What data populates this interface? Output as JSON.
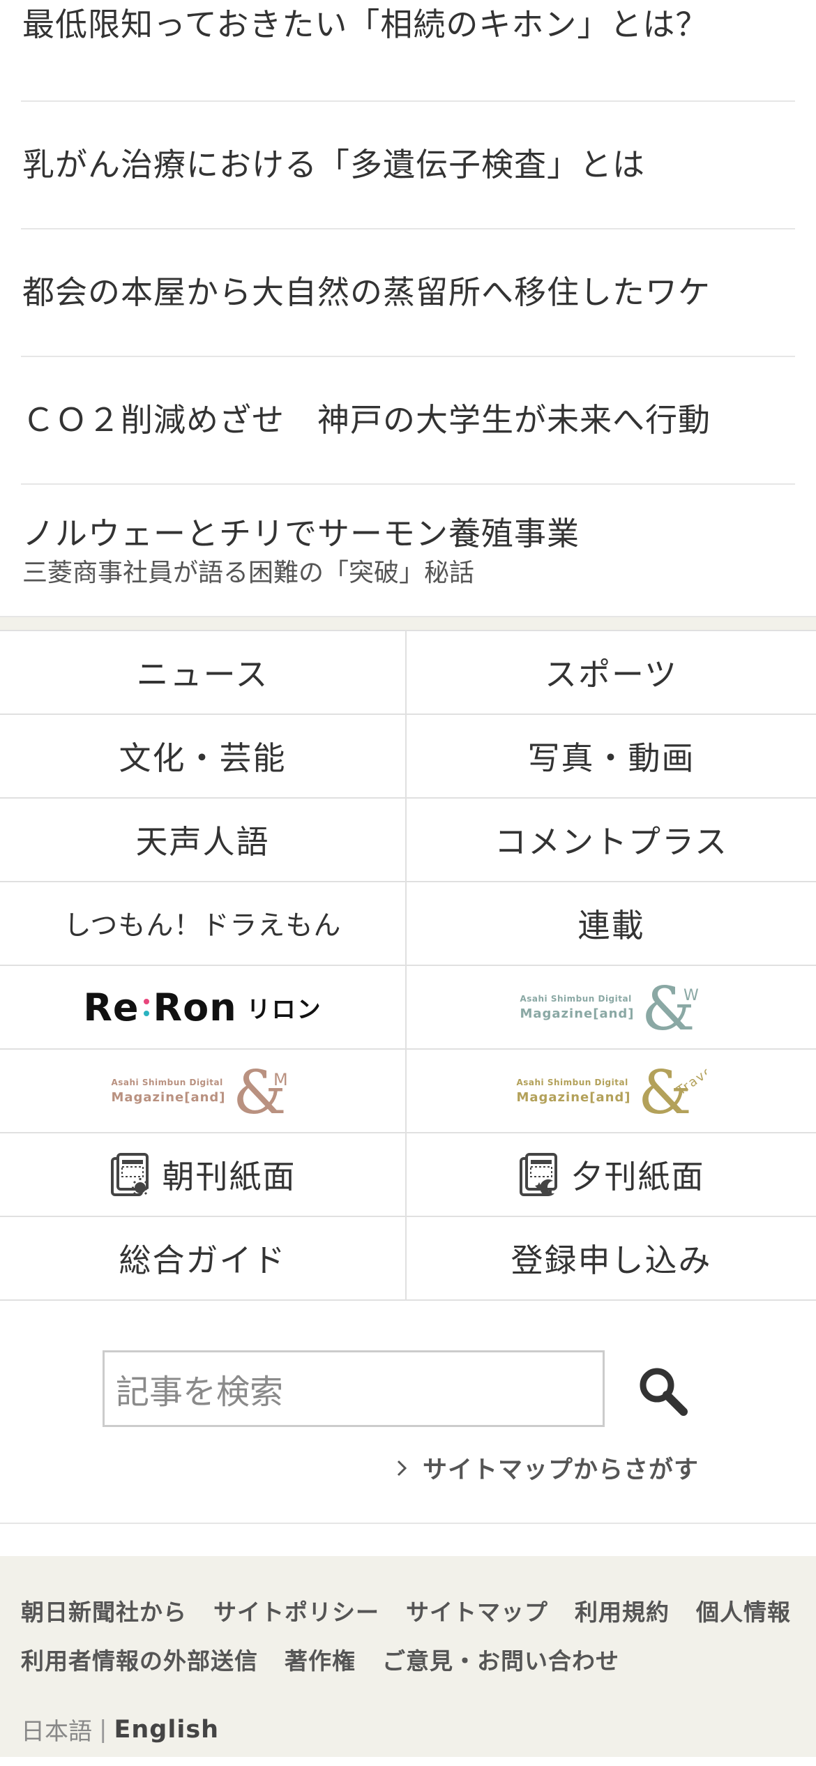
{
  "articles": [
    {
      "headline": "最低限知っておきたい「相続のキホン」とは？"
    },
    {
      "headline": "乳がん治療における「多遺伝子検査」とは"
    },
    {
      "headline": "都会の本屋から大自然の蒸留所へ移住したワケ"
    },
    {
      "headline": "ＣＯ２削減めざせ　神戸の大学生が未来へ行動"
    },
    {
      "headline": "ノルウェーとチリでサーモン養殖事業",
      "subhead": "三菱商事社員が語る困難の「突破」秘話"
    }
  ],
  "grid": {
    "news": "ニュース",
    "sports": "スポーツ",
    "culture": "文化・芸能",
    "photo_video": "写真・動画",
    "tensei_jingo": "天声人語",
    "comment_plus": "コメントプラス",
    "doraemon": "しつもん！ドラえもん",
    "serial": "連載",
    "reron": {
      "main": "Re:Ron",
      "kana": "リロン"
    },
    "magazine_w": {
      "line1": "Asahi Shimbun Digital",
      "line2": "Magazine[and]",
      "mark": "&",
      "suffix": "W",
      "color": "#8aa8a4"
    },
    "magazine_m": {
      "line1": "Asahi Shimbun Digital",
      "line2": "Magazine[and]",
      "mark": "&",
      "suffix": "M",
      "color": "#b99180"
    },
    "magazine_travel": {
      "line1": "Asahi Shimbun Digital",
      "line2": "Magazine[and]",
      "mark": "&",
      "suffix": "Travel",
      "color": "#b3a15a"
    },
    "morning_paper": "朝刊紙面",
    "evening_paper": "夕刊紙面",
    "guide": "総合ガイド",
    "signup": "登録申し込み"
  },
  "search": {
    "placeholder": "記事を検索",
    "sitemap_link": "サイトマップからさがす"
  },
  "footer": {
    "links": [
      "朝日新聞社から",
      "サイトポリシー",
      "サイトマップ",
      "利用規約",
      "個人情報",
      "利用者情報の外部送信",
      "著作権",
      "ご意見・お問い合わせ"
    ],
    "lang_ja": "日本語",
    "lang_sep": "|",
    "lang_en": "English"
  },
  "colors": {
    "text": "#333333",
    "footer_bg": "#f2f1ea",
    "border": "#e0e0e0",
    "reron_dots": [
      "#e8467c",
      "#2bb3c0",
      "#f2a62a"
    ]
  }
}
